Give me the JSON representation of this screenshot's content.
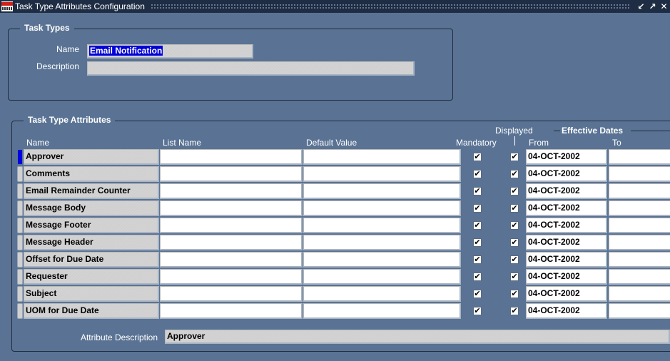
{
  "window": {
    "title": "Task Type Attributes Configuration",
    "controls": [
      "minimize-icon",
      "maximize-icon",
      "close-icon"
    ]
  },
  "task_types": {
    "frame_title": "Task Types",
    "name_label": "Name",
    "name_value": "Email Notification",
    "description_label": "Description",
    "description_value": ""
  },
  "attributes": {
    "frame_title": "Task Type Attributes",
    "headers": {
      "name": "Name",
      "list_name": "List Name",
      "default_value": "Default Value",
      "mandatory": "Mandatory",
      "displayed": "Displayed",
      "effective_dates": "Effective Dates",
      "from": "From",
      "to": "To"
    },
    "rows": [
      {
        "name": "Approver",
        "list_name": "",
        "default_value": "",
        "mandatory": true,
        "displayed": true,
        "from": "04-OCT-2002",
        "to": ""
      },
      {
        "name": "Comments",
        "list_name": "",
        "default_value": "",
        "mandatory": true,
        "displayed": true,
        "from": "04-OCT-2002",
        "to": ""
      },
      {
        "name": "Email Remainder Counter",
        "list_name": "",
        "default_value": "",
        "mandatory": true,
        "displayed": true,
        "from": "04-OCT-2002",
        "to": ""
      },
      {
        "name": "Message Body",
        "list_name": "",
        "default_value": "",
        "mandatory": true,
        "displayed": true,
        "from": "04-OCT-2002",
        "to": ""
      },
      {
        "name": "Message Footer",
        "list_name": "",
        "default_value": "",
        "mandatory": true,
        "displayed": true,
        "from": "04-OCT-2002",
        "to": ""
      },
      {
        "name": "Message Header",
        "list_name": "",
        "default_value": "",
        "mandatory": true,
        "displayed": true,
        "from": "04-OCT-2002",
        "to": ""
      },
      {
        "name": "Offset for Due Date",
        "list_name": "",
        "default_value": "",
        "mandatory": true,
        "displayed": true,
        "from": "04-OCT-2002",
        "to": ""
      },
      {
        "name": "Requester",
        "list_name": "",
        "default_value": "",
        "mandatory": true,
        "displayed": true,
        "from": "04-OCT-2002",
        "to": ""
      },
      {
        "name": "Subject",
        "list_name": "",
        "default_value": "",
        "mandatory": true,
        "displayed": true,
        "from": "04-OCT-2002",
        "to": ""
      },
      {
        "name": "UOM for Due Date",
        "list_name": "",
        "default_value": "",
        "mandatory": true,
        "displayed": true,
        "from": "04-OCT-2002",
        "to": ""
      }
    ],
    "current_row": 0,
    "attribute_description_label": "Attribute Description",
    "attribute_description_value": "Approver"
  },
  "icons": {
    "checkbox_checked": "✔"
  }
}
